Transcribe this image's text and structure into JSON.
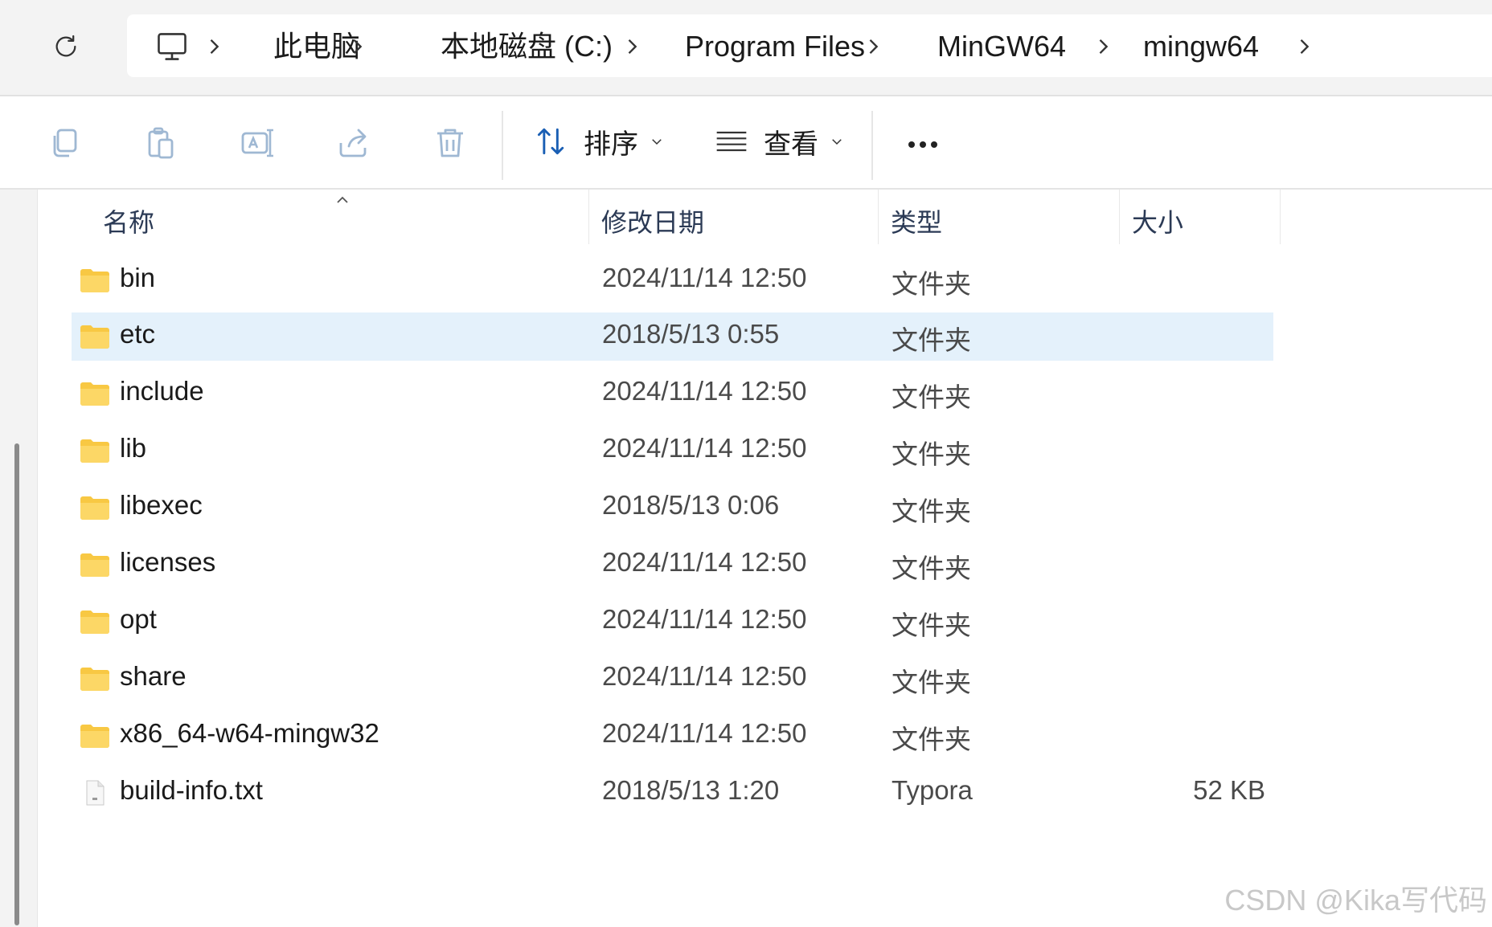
{
  "address_bar": {
    "breadcrumbs": [
      "此电脑",
      "本地磁盘 (C:)",
      "Program Files",
      "MinGW64",
      "mingw64"
    ]
  },
  "toolbar": {
    "sort_label": "排序",
    "view_label": "查看"
  },
  "columns": {
    "name": "名称",
    "modified": "修改日期",
    "type": "类型",
    "size": "大小"
  },
  "files": [
    {
      "name": "bin",
      "modified": "2024/11/14 12:50",
      "type": "文件夹",
      "size": "",
      "kind": "folder",
      "selected": false
    },
    {
      "name": "etc",
      "modified": "2018/5/13 0:55",
      "type": "文件夹",
      "size": "",
      "kind": "folder",
      "selected": true
    },
    {
      "name": "include",
      "modified": "2024/11/14 12:50",
      "type": "文件夹",
      "size": "",
      "kind": "folder",
      "selected": false
    },
    {
      "name": "lib",
      "modified": "2024/11/14 12:50",
      "type": "文件夹",
      "size": "",
      "kind": "folder",
      "selected": false
    },
    {
      "name": "libexec",
      "modified": "2018/5/13 0:06",
      "type": "文件夹",
      "size": "",
      "kind": "folder",
      "selected": false
    },
    {
      "name": "licenses",
      "modified": "2024/11/14 12:50",
      "type": "文件夹",
      "size": "",
      "kind": "folder",
      "selected": false
    },
    {
      "name": "opt",
      "modified": "2024/11/14 12:50",
      "type": "文件夹",
      "size": "",
      "kind": "folder",
      "selected": false
    },
    {
      "name": "share",
      "modified": "2024/11/14 12:50",
      "type": "文件夹",
      "size": "",
      "kind": "folder",
      "selected": false
    },
    {
      "name": "x86_64-w64-mingw32",
      "modified": "2024/11/14 12:50",
      "type": "文件夹",
      "size": "",
      "kind": "folder",
      "selected": false
    },
    {
      "name": "build-info.txt",
      "modified": "2018/5/13 1:20",
      "type": "Typora",
      "size": "52 KB",
      "kind": "file",
      "selected": false
    }
  ],
  "watermark": "CSDN @Kika写代码",
  "colors": {
    "selected_row": "#e4f1fb",
    "folder_yellow": "#f8c843",
    "accent": "#1a5fb4"
  }
}
